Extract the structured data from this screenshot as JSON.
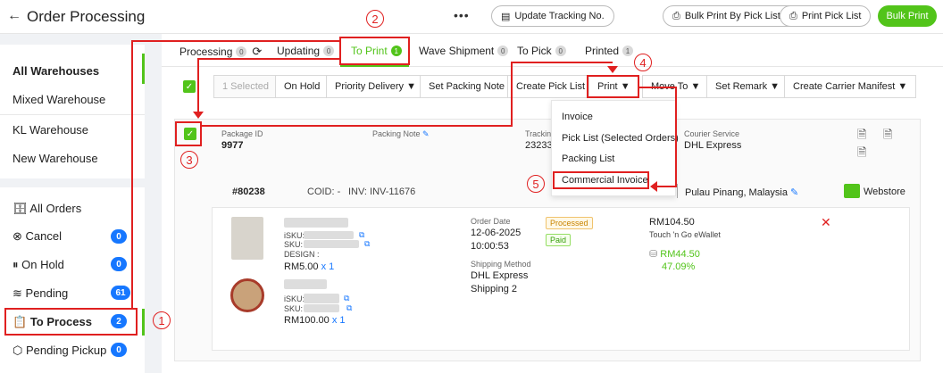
{
  "header": {
    "back_icon": "arrow-left-icon",
    "title": "Order Processing",
    "more": "•••",
    "update_tracking": "Update Tracking No.",
    "bulk_print_pick": "Bulk Print By Pick List No",
    "print_pick_list": "Print Pick List",
    "bulk_print": "Bulk Print"
  },
  "warehouses": [
    "All Warehouses",
    "Mixed Warehouse",
    "KL Warehouse",
    "New Warehouse"
  ],
  "status_menu": [
    {
      "label": "All Orders",
      "count": ""
    },
    {
      "label": "Cancel",
      "count": "0"
    },
    {
      "label": "On Hold",
      "count": "0"
    },
    {
      "label": "Pending",
      "count": "61"
    },
    {
      "label": "To Process",
      "count": "2"
    },
    {
      "label": "Pending Pickup",
      "count": "0"
    }
  ],
  "tabs": [
    {
      "label": "Processing",
      "count": "0"
    },
    {
      "label": "Updating",
      "count": "0"
    },
    {
      "label": "To Print",
      "count": "1"
    },
    {
      "label": "Wave Shipment",
      "count": "0"
    },
    {
      "label": "To Pick",
      "count": "0"
    },
    {
      "label": "Printed",
      "count": "1"
    }
  ],
  "toolbar": {
    "selected": "1 Selected",
    "on_hold": "On Hold",
    "priority": "Priority Delivery",
    "packing_note": "Set Packing Note",
    "pick_list": "Create Pick List",
    "print": "Print",
    "move_to": "Move To",
    "remark": "Set Remark",
    "carrier": "Create Carrier Manifest",
    "caret": "▼"
  },
  "package": {
    "id_label": "Package ID",
    "id": "9977",
    "note_label": "Packing Note",
    "tracking_label": "Trackin",
    "tracking": "23233",
    "courier_label": "Courier Service",
    "courier": "DHL Express"
  },
  "print_menu": [
    "Invoice",
    "Pick List (Selected Orders)",
    "Packing List",
    "Commercial Invoice"
  ],
  "order": {
    "id": "#80238",
    "coid": "COID: -",
    "inv": "INV: INV-11676",
    "location": "Pulau Pinang, Malaysia",
    "store": "Webstore",
    "date_label": "Order Date",
    "date": "12-06-2025",
    "time": "10:00:53",
    "ship_label": "Shipping Method",
    "ship": "DHL Express",
    "ship2": "Shipping 2",
    "status1": "Processed",
    "status2": "Paid",
    "amount": "RM104.50",
    "payment": "Touch 'n Go eWallet",
    "profit": "RM44.50",
    "profit_pct": "47.09%",
    "items": [
      {
        "isku": "iSKU:",
        "sku": "SKU:",
        "design": "DESIGN :",
        "price": "RM5.00",
        "qty": "x 1"
      },
      {
        "isku": "iSKU:",
        "sku": "SKU:",
        "design": "",
        "price": "RM100.00",
        "qty": "x 1"
      }
    ]
  },
  "annotations": [
    "1",
    "2",
    "3",
    "4",
    "5"
  ],
  "colors": {
    "accent": "#52c41a",
    "highlight": "#e02020",
    "badge": "#1677ff"
  }
}
